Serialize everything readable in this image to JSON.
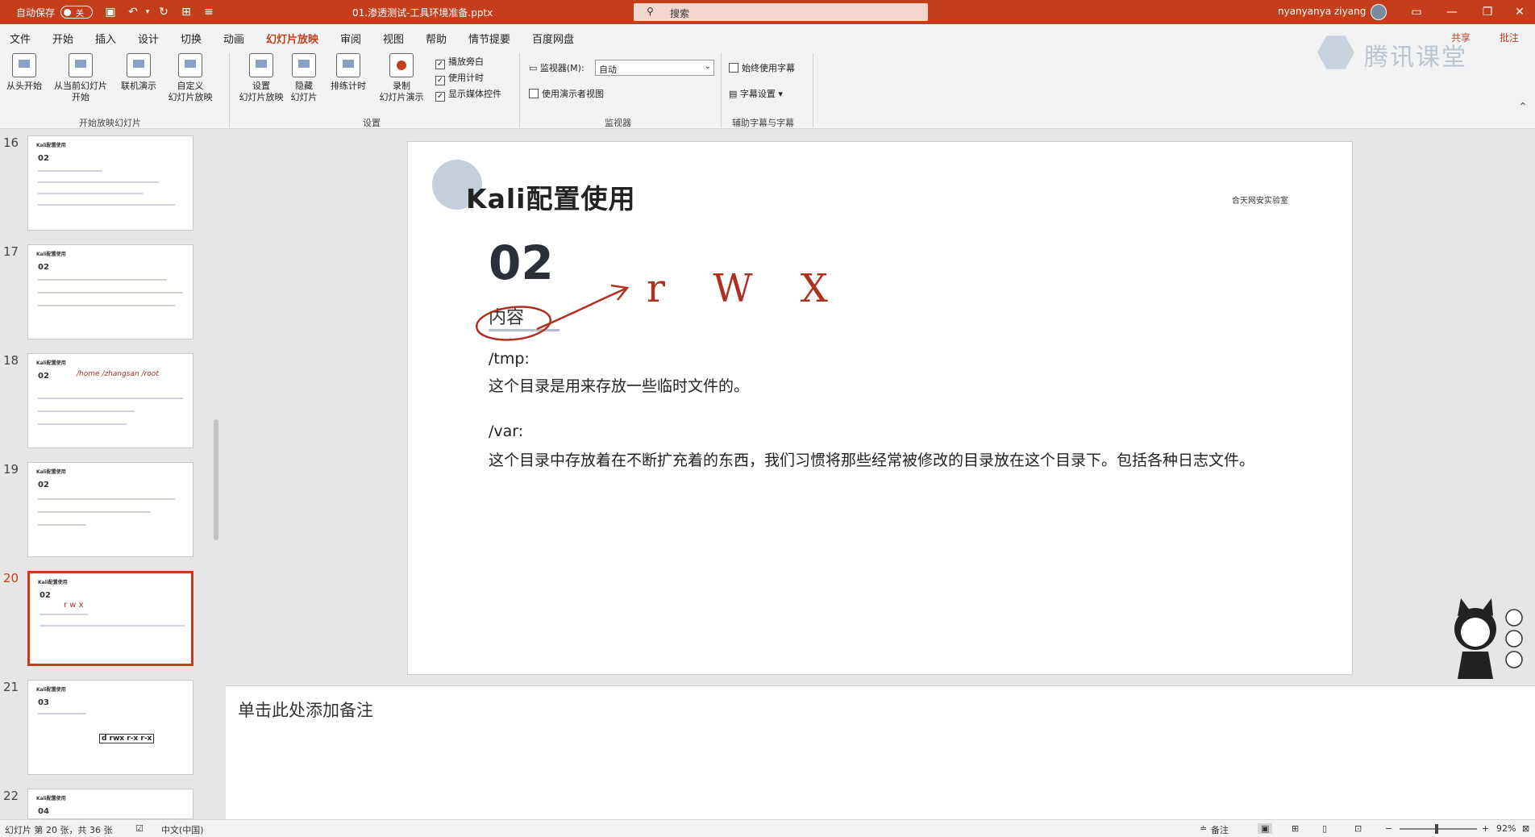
{
  "titlebar": {
    "autosave_label": "自动保存",
    "autosave_state": "关",
    "filename": "01.渗透测试-工具环境准备.pptx",
    "search_placeholder": "搜索",
    "user": "nyanyanya ziyang"
  },
  "tabs": [
    "文件",
    "开始",
    "插入",
    "设计",
    "切换",
    "动画",
    "幻灯片放映",
    "审阅",
    "视图",
    "帮助",
    "情节提要",
    "百度网盘"
  ],
  "active_tab": "幻灯片放映",
  "tab_right": {
    "share": "共享",
    "comments": "批注"
  },
  "ribbon": {
    "start_group": {
      "label": "开始放映幻灯片",
      "from_start": "从头开始",
      "from_current_l1": "从当前幻灯片",
      "from_current_l2": "开始",
      "online": "联机演示",
      "custom_l1": "自定义",
      "custom_l2": "幻灯片放映"
    },
    "setup_group": {
      "label": "设置",
      "setup_l1": "设置",
      "setup_l2": "幻灯片放映",
      "hide_l1": "隐藏",
      "hide_l2": "幻灯片",
      "rehearse": "排练计时",
      "record_l1": "录制",
      "record_l2": "幻灯片演示",
      "chk_narration": "播放旁白",
      "chk_timing": "使用计时",
      "chk_media": "显示媒体控件"
    },
    "monitor_group": {
      "label": "监视器",
      "monitor_label": "监视器(M):",
      "monitor_value": "自动",
      "presenter_view": "使用演示者视图"
    },
    "caption_group": {
      "label": "辅助字幕与字幕",
      "always_subtitles": "始终使用字幕",
      "subtitle_settings": "字幕设置"
    }
  },
  "watermark": "腾讯课堂",
  "thumbnails": [
    {
      "num": "16",
      "title": "Kali配置使用",
      "section": "02"
    },
    {
      "num": "17",
      "title": "Kali配置使用",
      "section": "02"
    },
    {
      "num": "18",
      "title": "Kali配置使用",
      "section": "02",
      "ink": "/home /zhangsan /root"
    },
    {
      "num": "19",
      "title": "Kali配置使用",
      "section": "02"
    },
    {
      "num": "20",
      "title": "Kali配置使用",
      "section": "02",
      "ink": "r w x"
    },
    {
      "num": "21",
      "title": "Kali配置使用",
      "section": "03",
      "perm": "d rwx r-x r-x"
    },
    {
      "num": "22",
      "title": "Kali配置使用",
      "section": "04"
    }
  ],
  "active_slide": "20",
  "slide": {
    "title": "Kali配置使用",
    "logo": "合天网安实验室",
    "section_num": "02",
    "section_sub": "内容",
    "p1_head": "/tmp:",
    "p1_body": "这个目录是用来存放一些临时文件的。",
    "p2_head": "/var:",
    "p2_body": "这个目录中存放着在不断扩充着的东西，我们习惯将那些经常被修改的目录放在这个目录下。包括各种日志文件。",
    "ink_text": "r W X"
  },
  "notes_placeholder": "单击此处添加备注",
  "statusbar": {
    "slide_info": "幻灯片 第 20 张，共 36 张",
    "language": "中文(中国)",
    "notes_btn": "备注",
    "zoom": "92%"
  },
  "colors": {
    "accent": "#c43e1c",
    "ink": "#b03020"
  }
}
